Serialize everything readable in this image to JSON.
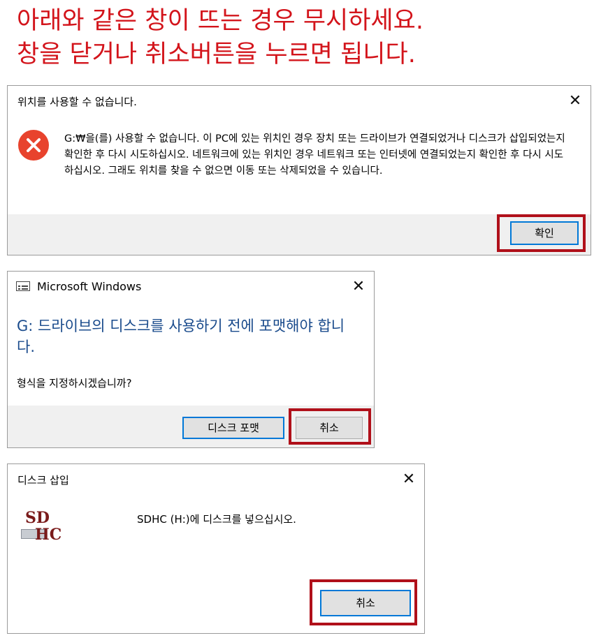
{
  "heading": {
    "line1": "아래와 같은 창이 뜨는 경우 무시하세요.",
    "line2": "창을 닫거나 취소버튼을 누르면 됩니다."
  },
  "dialog1": {
    "title": "위치를 사용할 수 없습니다.",
    "message": "G:₩을(를) 사용할 수 없습니다. 이 PC에 있는 위치인 경우 장치 또는 드라이브가 연결되었거나 디스크가 삽입되었는지 확인한 후 다시 시도하십시오. 네트워크에 있는 위치인 경우 네트워크 또는 인터넷에 연결되었는지 확인한 후 다시 시도하십시오. 그래도 위치를 찾을 수 없으면 이동 또는 삭제되었을 수 있습니다.",
    "ok_label": "확인",
    "close_glyph": "✕",
    "icon": "error-icon"
  },
  "dialog2": {
    "title": "Microsoft Windows",
    "heading": "G: 드라이브의 디스크를 사용하기 전에 포맷해야 합니다.",
    "question": "형식을 지정하시겠습니까?",
    "format_label": "디스크 포맷",
    "cancel_label": "취소",
    "close_glyph": "✕"
  },
  "dialog3": {
    "title": "디스크 삽입",
    "message": "SDHC (H:)에 디스크를 넣으십시오.",
    "cancel_label": "취소",
    "close_glyph": "✕",
    "icon_text_top": "SD",
    "icon_text_bottom": "HC"
  },
  "colors": {
    "heading_red": "#d3141b",
    "highlight_red": "#b0101a",
    "accent_blue": "#0078d7",
    "dialog_heading_blue": "#1a4b8c",
    "error_red": "#e8432d"
  }
}
